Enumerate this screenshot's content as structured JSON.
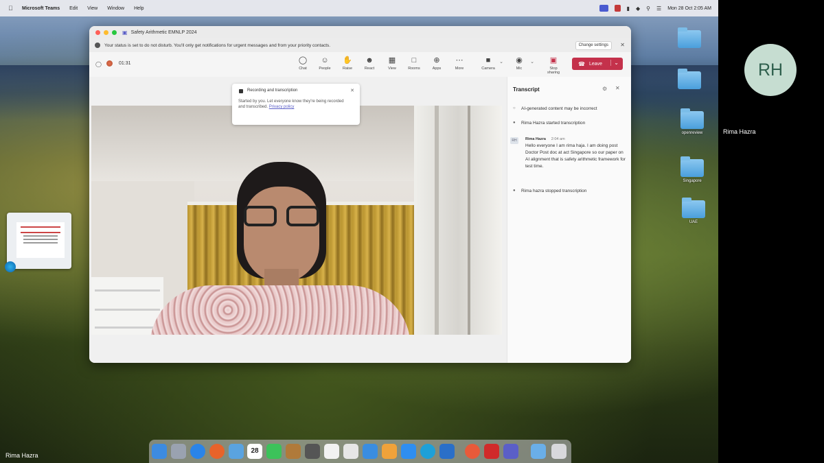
{
  "menubar": {
    "app_name": "Microsoft Teams",
    "menus": [
      "Edit",
      "View",
      "Window",
      "Help"
    ],
    "clock": "Mon 28 Oct  2:05 AM"
  },
  "desktop": {
    "folders": [
      {
        "label": ""
      },
      {
        "label": ""
      },
      {
        "label": "openreview"
      },
      {
        "label": "Singapore"
      },
      {
        "label": "UAE"
      }
    ]
  },
  "window": {
    "title": "Safety Arithmetic EMNLP 2024",
    "dnd_text": "Your status is set to do not disturb. You'll only get notifications for urgent messages and from your priority contacts.",
    "change_settings": "Change settings",
    "timer": "01:31",
    "toolbar": [
      {
        "label": "Chat",
        "icon": "chat-icon"
      },
      {
        "label": "People",
        "icon": "people-icon"
      },
      {
        "label": "Raise",
        "icon": "raise-hand-icon"
      },
      {
        "label": "React",
        "icon": "react-icon"
      },
      {
        "label": "View",
        "icon": "view-icon"
      },
      {
        "label": "Rooms",
        "icon": "rooms-icon"
      },
      {
        "label": "Apps",
        "icon": "apps-icon"
      },
      {
        "label": "More",
        "icon": "more-icon"
      }
    ],
    "camera_label": "Camera",
    "mic_label": "Mic",
    "share_label": "Stop sharing",
    "leave_label": "Leave"
  },
  "notice": {
    "title": "Recording and transcription",
    "body": "Started by you. Let everyone know they're being recorded and transcribed.",
    "link": "Privacy policy"
  },
  "transcript": {
    "title": "Transcript",
    "ai_note": "AI-generated content may be incorrect",
    "started": "Rima Hazra started transcription",
    "speaker": "Rima Hazra",
    "time": "2:04 am",
    "message": "Hello everyone I am rima haja. I am doing post Doctor Post doc at act Singapore so our paper on AI alignment that is safety arithmetic framework for test time.",
    "stopped": "Rima hazra stopped transcription"
  },
  "participant": {
    "initials": "RH",
    "name": "Rima Hazra"
  },
  "bottom_label": "Rima Hazra",
  "dock": {
    "calendar_day": "28"
  },
  "colors": {
    "leave": "#c4314b",
    "teams_accent": "#5b5fc7",
    "avatar_bg": "#c6ddd1"
  }
}
